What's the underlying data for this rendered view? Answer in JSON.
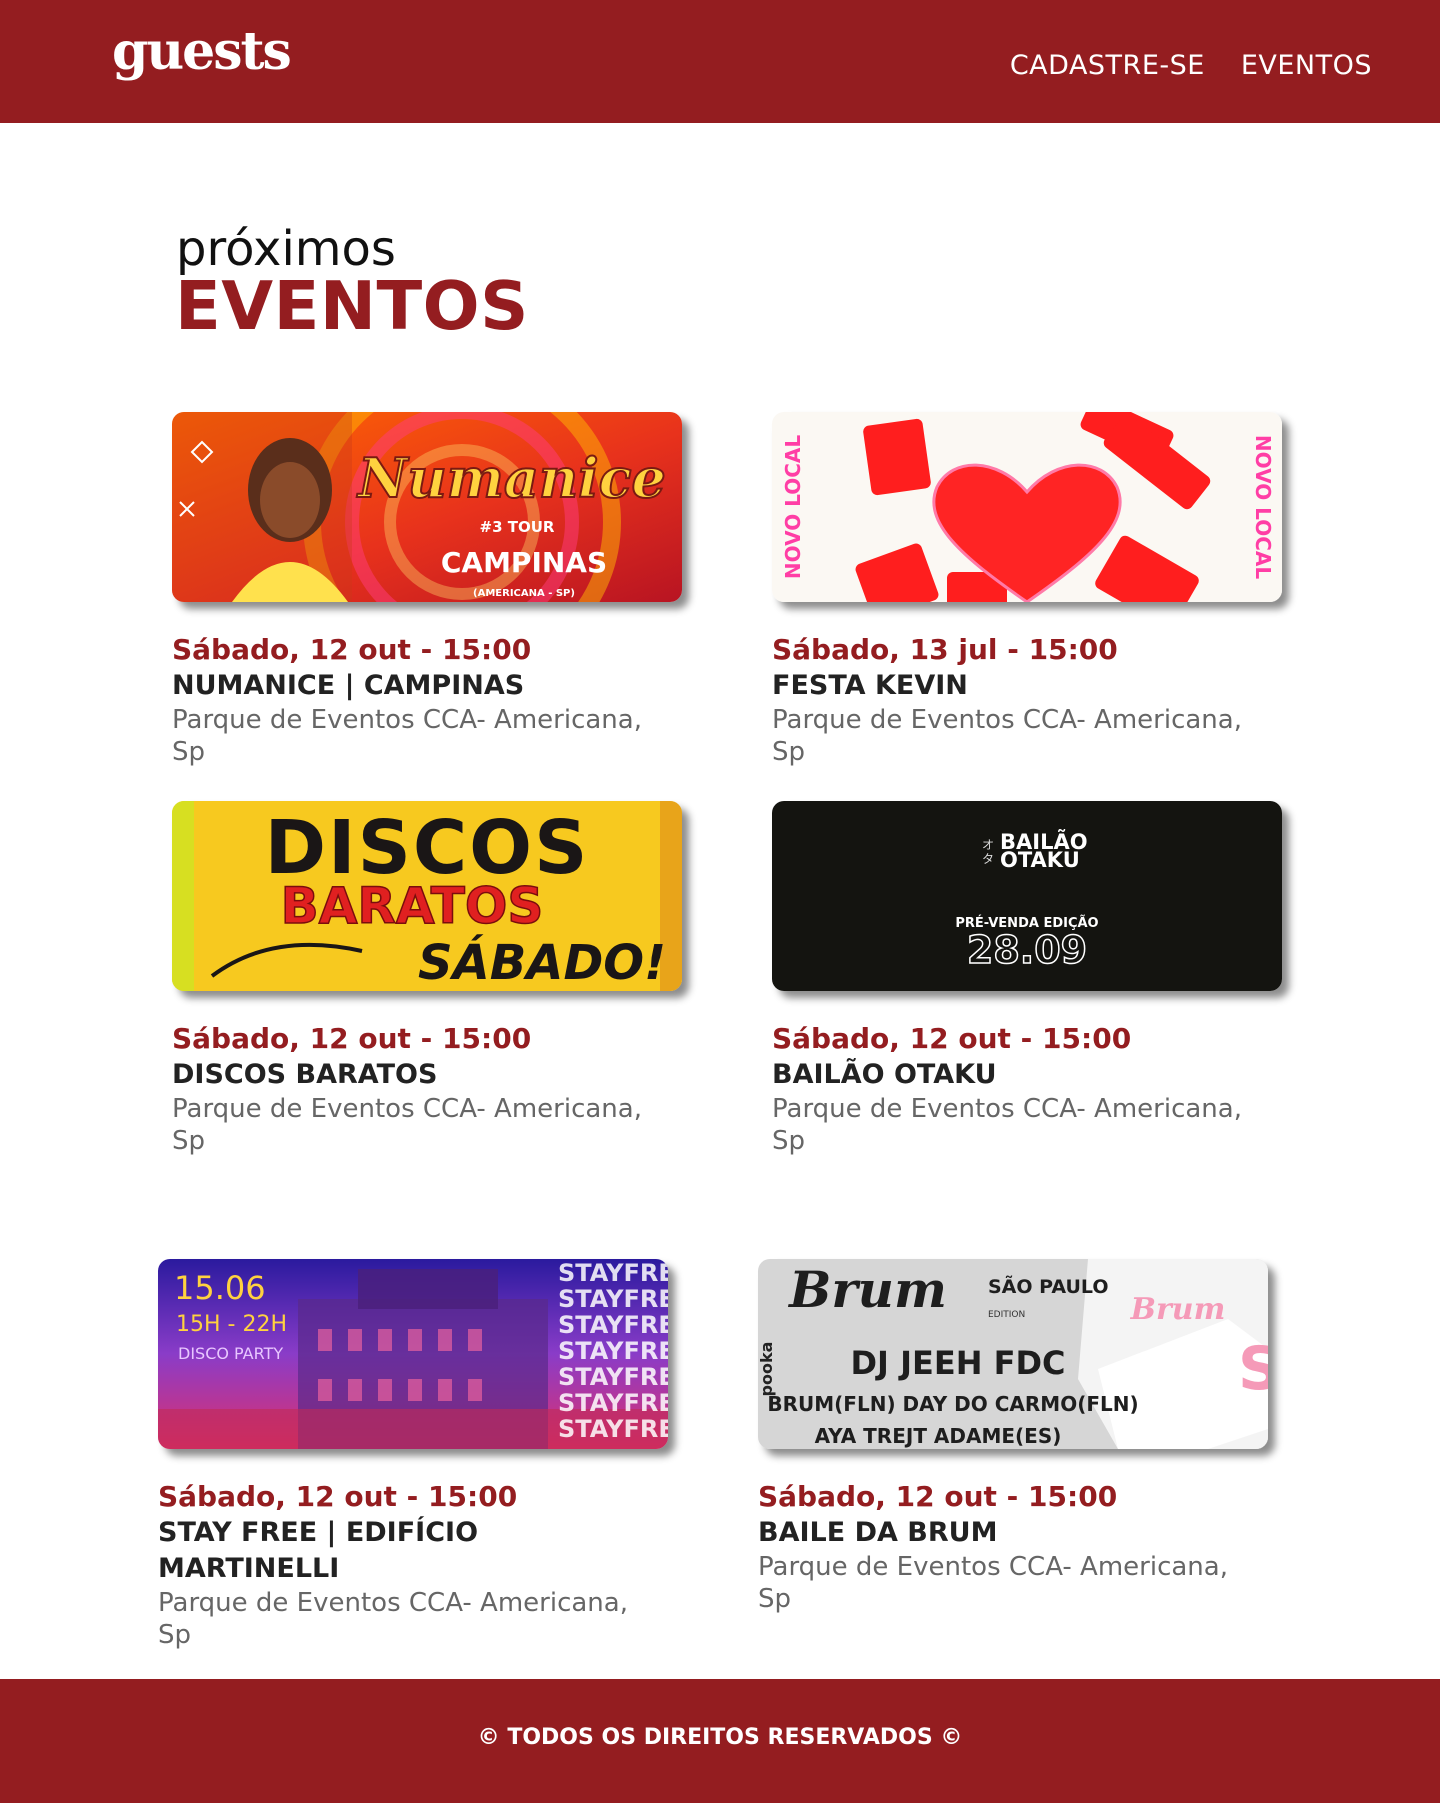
{
  "header": {
    "logo": "guests",
    "nav": [
      {
        "label": "CADASTRE-SE"
      },
      {
        "label": "EVENTOS"
      }
    ]
  },
  "heading": {
    "small": "próximos",
    "big": "EVENTOS"
  },
  "events": [
    {
      "date": "Sábado, 12 out - 15:00",
      "title": "NUMANICE | CAMPINAS",
      "venue": "Parque de Eventos CCA- Americana, Sp",
      "banner": {
        "title": "Numanice",
        "sub": "#3 TOUR",
        "city": "CAMPINAS",
        "small": "(AMERICANA - SP)"
      }
    },
    {
      "date": "Sábado, 13 jul - 15:00",
      "title": "FESTA KEVIN",
      "venue": "Parque de Eventos CCA- Americana, Sp",
      "banner": {
        "side": "NOVO LOCAL"
      }
    },
    {
      "date": "Sábado, 12 out - 15:00",
      "title": "DISCOS BARATOS",
      "venue": "Parque de Eventos CCA- Americana, Sp",
      "banner": {
        "line1": "DISCOS",
        "line2": "BARATOS",
        "line3": "SÁBADO!"
      }
    },
    {
      "date": "Sábado, 12 out - 15:00",
      "title": "BAILÃO OTAKU",
      "venue": "Parque de Eventos CCA- Americana, Sp",
      "banner": {
        "name1": "BAILÃO",
        "name2": "OTAKU",
        "presale": "PRÉ-VENDA EDIÇÃO",
        "edition": "28.09"
      }
    },
    {
      "date": "Sábado, 12 out - 15:00",
      "title": "STAY FREE | EDIFÍCIO MARTINELLI",
      "venue": "Parque de Eventos CCA- Americana, Sp",
      "banner": {
        "day": "15.06",
        "hours": "15H - 22H",
        "kind": "DISCO PARTY",
        "repeat": "STAYFRE"
      }
    },
    {
      "date": "Sábado, 12 out - 15:00",
      "title": "BAILE DA BRUM",
      "venue": "Parque de Eventos CCA- Americana, Sp",
      "banner": {
        "brand": "Brum",
        "city": "SÃO PAULO",
        "edition": "EDITION",
        "headliner": "DJ JEEH FDC",
        "lineup": "BRUM(FLN)  DAY DO CARMO(FLN)",
        "lineup2": "AYA TREJT  ADAME(ES)",
        "side": "pooka"
      }
    }
  ],
  "footer": {
    "copyright": "© TODOS OS DIREITOS RESERVADOS ©"
  },
  "colors": {
    "brand": "#941d20",
    "text": "#222222",
    "muted": "#666666"
  }
}
